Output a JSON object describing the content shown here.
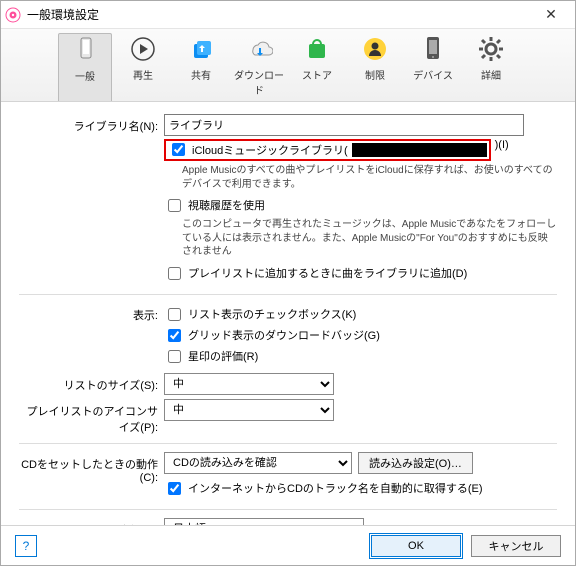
{
  "window": {
    "title": "一般環境設定"
  },
  "toolbar": [
    {
      "label": "一般"
    },
    {
      "label": "再生"
    },
    {
      "label": "共有"
    },
    {
      "label": "ダウンロード"
    },
    {
      "label": "ストア"
    },
    {
      "label": "制限"
    },
    {
      "label": "デバイス"
    },
    {
      "label": "詳細"
    }
  ],
  "library": {
    "name_label": "ライブラリ名(N):",
    "name_value": "ライブラリ",
    "icloud_label": "iCloudミュージックライブラリ(",
    "icloud_suffix": ")(I)",
    "icloud_desc": "Apple Musicのすべての曲やプレイリストをiCloudに保存すれば、お使いのすべてのデバイスで利用できます。",
    "history_label": "視聴履歴を使用",
    "history_desc": "このコンピュータで再生されたミュージックは、Apple Musicであなたをフォローしている人には表示されません。また、Apple Musicの\"For You\"のおすすめにも反映されません",
    "playlist_add_label": "プレイリストに追加するときに曲をライブラリに追加(D)"
  },
  "display": {
    "label": "表示:",
    "list_checkbox": "リスト表示のチェックボックス(K)",
    "grid_badge": "グリッド表示のダウンロードバッジ(G)",
    "star_rating": "星印の評価(R)"
  },
  "list_size": {
    "label": "リストのサイズ(S):",
    "value": "中"
  },
  "playlist_icon_size": {
    "label": "プレイリストのアイコンサイズ(P):",
    "value": "中"
  },
  "cd": {
    "label": "CDをセットしたときの動作(C):",
    "value": "CDの読み込みを確認",
    "import_settings": "読み込み設定(O)…",
    "internet_track": "インターネットからCDのトラック名を自動的に取得する(E)"
  },
  "language": {
    "label": "言語(L):",
    "value": "日本語"
  },
  "footer": {
    "help": "?",
    "ok": "OK",
    "cancel": "キャンセル"
  }
}
